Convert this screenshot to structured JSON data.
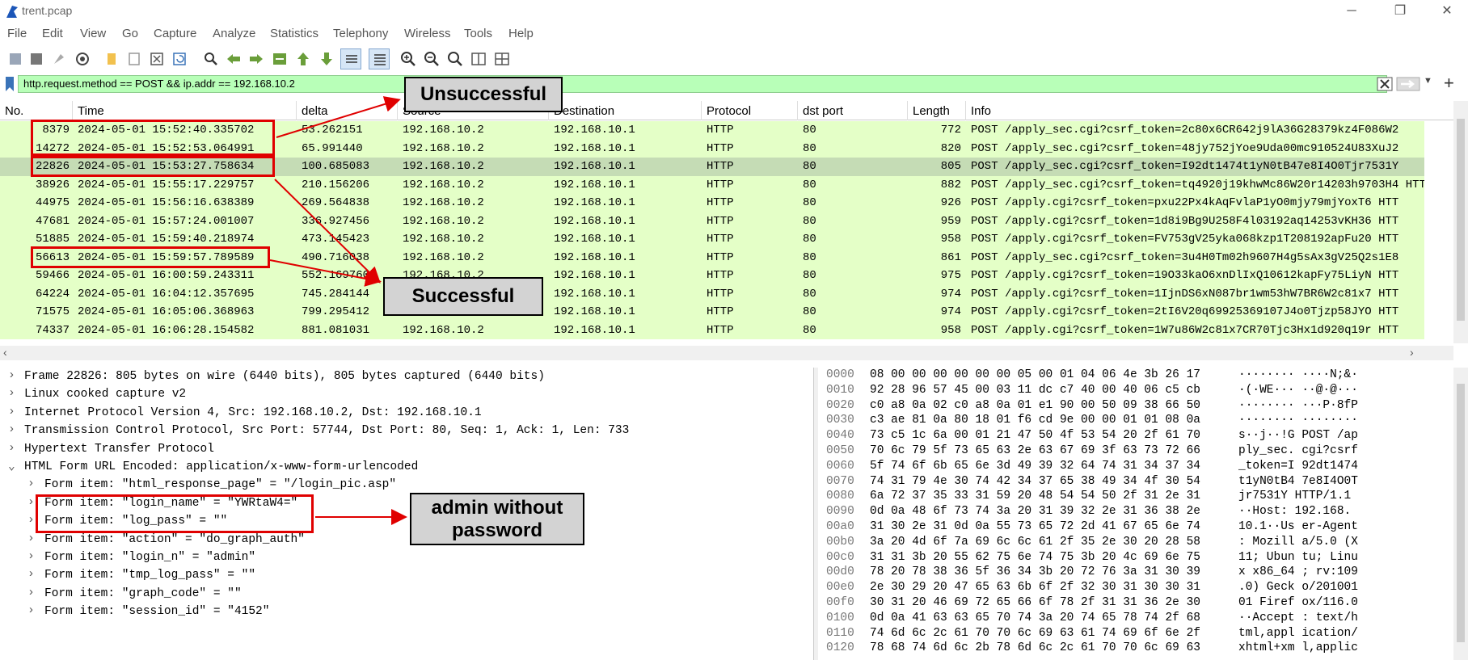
{
  "window": {
    "title": "trent.pcap"
  },
  "menu": [
    "File",
    "Edit",
    "View",
    "Go",
    "Capture",
    "Analyze",
    "Statistics",
    "Telephony",
    "Wireless",
    "Tools",
    "Help"
  ],
  "filter": {
    "value": "http.request.method == POST && ip.addr == 192.168.10.2"
  },
  "columns": [
    "No.",
    "Time",
    "delta",
    "Source",
    "Destination",
    "Protocol",
    "dst port",
    "Length",
    "Info"
  ],
  "packets": [
    {
      "no": "8379",
      "time": "2024-05-01 15:52:40.335702",
      "delta": "53.262151",
      "src": "192.168.10.2",
      "dst": "192.168.10.1",
      "proto": "HTTP",
      "port": "80",
      "len": "772",
      "info": "POST /apply_sec.cgi?csrf_token=2c80x6CR642j9lA36G28379kz4F086W2"
    },
    {
      "no": "14272",
      "time": "2024-05-01 15:52:53.064991",
      "delta": "65.991440",
      "src": "192.168.10.2",
      "dst": "192.168.10.1",
      "proto": "HTTP",
      "port": "80",
      "len": "820",
      "info": "POST /apply_sec.cgi?csrf_token=48jy752jYoe9Uda00mc910524U83XuJ2"
    },
    {
      "no": "22826",
      "time": "2024-05-01 15:53:27.758634",
      "delta": "100.685083",
      "src": "192.168.10.2",
      "dst": "192.168.10.1",
      "proto": "HTTP",
      "port": "80",
      "len": "805",
      "info": "POST /apply_sec.cgi?csrf_token=I92dt1474t1yN0tB47e8I4O0Tjr7531Y"
    },
    {
      "no": "38926",
      "time": "2024-05-01 15:55:17.229757",
      "delta": "210.156206",
      "src": "192.168.10.2",
      "dst": "192.168.10.1",
      "proto": "HTTP",
      "port": "80",
      "len": "882",
      "info": "POST /apply_sec.cgi?csrf_token=tq4920j19khwMc86W20r14203h9703H4  HTT"
    },
    {
      "no": "44975",
      "time": "2024-05-01 15:56:16.638389",
      "delta": "269.564838",
      "src": "192.168.10.2",
      "dst": "192.168.10.1",
      "proto": "HTTP",
      "port": "80",
      "len": "926",
      "info": "POST /apply.cgi?csrf_token=pxu22Px4kAqFvlaP1yO0mjy79mjYoxT6  HTT"
    },
    {
      "no": "47681",
      "time": "2024-05-01 15:57:24.001007",
      "delta": "336.927456",
      "src": "192.168.10.2",
      "dst": "192.168.10.1",
      "proto": "HTTP",
      "port": "80",
      "len": "959",
      "info": "POST /apply.cgi?csrf_token=1d8i9Bg9U258F4l03192aq14253vKH36  HTT"
    },
    {
      "no": "51885",
      "time": "2024-05-01 15:59:40.218974",
      "delta": "473.145423",
      "src": "192.168.10.2",
      "dst": "192.168.10.1",
      "proto": "HTTP",
      "port": "80",
      "len": "958",
      "info": "POST /apply.cgi?csrf_token=FV753gV25yka068kzp1T208192apFu20  HTT"
    },
    {
      "no": "56613",
      "time": "2024-05-01 15:59:57.789589",
      "delta": "490.716038",
      "src": "192.168.10.2",
      "dst": "192.168.10.1",
      "proto": "HTTP",
      "port": "80",
      "len": "861",
      "info": "POST /apply_sec.cgi?csrf_token=3u4H0Tm02h9607H4g5sAx3gV25Q2s1E8"
    },
    {
      "no": "59466",
      "time": "2024-05-01 16:00:59.243311",
      "delta": "552.169760",
      "src": "192.168.10.2",
      "dst": "192.168.10.1",
      "proto": "HTTP",
      "port": "80",
      "len": "975",
      "info": "POST /apply.cgi?csrf_token=19O33kaO6xnDlIxQ10612kapFy75LiyN  HTT"
    },
    {
      "no": "64224",
      "time": "2024-05-01 16:04:12.357695",
      "delta": "745.284144",
      "src": "192.168.10.2",
      "dst": "192.168.10.1",
      "proto": "HTTP",
      "port": "80",
      "len": "974",
      "info": "POST /apply.cgi?csrf_token=1IjnDS6xN087br1wm53hW7BR6W2c81x7  HTT"
    },
    {
      "no": "71575",
      "time": "2024-05-01 16:05:06.368963",
      "delta": "799.295412",
      "src": "192.168.10.2",
      "dst": "192.168.10.1",
      "proto": "HTTP",
      "port": "80",
      "len": "974",
      "info": "POST /apply.cgi?csrf_token=2tI6V20q69925369107J4o0Tjzp58JYO  HTT"
    },
    {
      "no": "74337",
      "time": "2024-05-01 16:06:28.154582",
      "delta": "881.081031",
      "src": "192.168.10.2",
      "dst": "192.168.10.1",
      "proto": "HTTP",
      "port": "80",
      "len": "958",
      "info": "POST /apply.cgi?csrf_token=1W7u86W2c81x7CR70Tjc3Hx1d920q19r  HTT"
    }
  ],
  "details": [
    {
      "text": "Frame 22826: 805 bytes on wire (6440 bits), 805 bytes captured (6440 bits)",
      "chev": "›",
      "child": false
    },
    {
      "text": "Linux cooked capture v2",
      "chev": "›",
      "child": false
    },
    {
      "text": "Internet Protocol Version 4, Src: 192.168.10.2, Dst: 192.168.10.1",
      "chev": "›",
      "child": false
    },
    {
      "text": "Transmission Control Protocol, Src Port: 57744, Dst Port: 80, Seq: 1, Ack: 1, Len: 733",
      "chev": "›",
      "child": false
    },
    {
      "text": "Hypertext Transfer Protocol",
      "chev": "›",
      "child": false
    },
    {
      "text": "HTML Form URL Encoded: application/x-www-form-urlencoded",
      "chev": "⌄",
      "child": false
    },
    {
      "text": "Form item: \"html_response_page\" = \"/login_pic.asp\"",
      "chev": "›",
      "child": true
    },
    {
      "text": "Form item: \"login_name\" = \"YWRtaW4=\"",
      "chev": "›",
      "child": true
    },
    {
      "text": "Form item: \"log_pass\" = \"\"",
      "chev": "›",
      "child": true
    },
    {
      "text": "Form item: \"action\" = \"do_graph_auth\"",
      "chev": "›",
      "child": true
    },
    {
      "text": "Form item: \"login_n\" = \"admin\"",
      "chev": "›",
      "child": true
    },
    {
      "text": "Form item: \"tmp_log_pass\" = \"\"",
      "chev": "›",
      "child": true
    },
    {
      "text": "Form item: \"graph_code\" = \"\"",
      "chev": "›",
      "child": true
    },
    {
      "text": "Form item: \"session_id\" = \"4152\"",
      "chev": "›",
      "child": true
    }
  ],
  "hex": [
    {
      "off": "0000",
      "bytes": "08 00 00 00 00 00 00 05  00 01 04 06 4e 3b 26 17",
      "ascii": "········ ····N;&·"
    },
    {
      "off": "0010",
      "bytes": "92 28 96 57 45 00 03 11  dc c7 40 00 40 06 c5 cb",
      "ascii": "·(·WE··· ··@·@···"
    },
    {
      "off": "0020",
      "bytes": "c0 a8 0a 02 c0 a8 0a 01  e1 90 00 50 09 38 66 50",
      "ascii": "········ ···P·8fP"
    },
    {
      "off": "0030",
      "bytes": "c3 ae 81 0a 80 18 01 f6  cd 9e 00 00 01 01 08 0a",
      "ascii": "········ ········"
    },
    {
      "off": "0040",
      "bytes": "73 c5 1c 6a 00 01 21 47  50 4f 53 54 20 2f 61 70",
      "ascii": "s··j··!G POST /ap"
    },
    {
      "off": "0050",
      "bytes": "70 6c 79 5f 73 65 63 2e  63 67 69 3f 63 73 72 66",
      "ascii": "ply_sec. cgi?csrf"
    },
    {
      "off": "0060",
      "bytes": "5f 74 6f 6b 65 6e 3d 49  39 32 64 74 31 34 37 34",
      "ascii": "_token=I 92dt1474"
    },
    {
      "off": "0070",
      "bytes": "74 31 79 4e 30 74 42 34  37 65 38 49 34 4f 30 54",
      "ascii": "t1yN0tB4 7e8I4O0T"
    },
    {
      "off": "0080",
      "bytes": "6a 72 37 35 33 31 59 20  48 54 54 50 2f 31 2e 31",
      "ascii": "jr7531Y  HTTP/1.1"
    },
    {
      "off": "0090",
      "bytes": "0d 0a 48 6f 73 74 3a 20  31 39 32 2e 31 36 38 2e",
      "ascii": "··Host:  192.168."
    },
    {
      "off": "00a0",
      "bytes": "31 30 2e 31 0d 0a 55 73  65 72 2d 41 67 65 6e 74",
      "ascii": "10.1··Us er-Agent"
    },
    {
      "off": "00b0",
      "bytes": "3a 20 4d 6f 7a 69 6c 6c  61 2f 35 2e 30 20 28 58",
      "ascii": ": Mozill a/5.0 (X"
    },
    {
      "off": "00c0",
      "bytes": "31 31 3b 20 55 62 75 6e  74 75 3b 20 4c 69 6e 75",
      "ascii": "11; Ubun tu; Linu"
    },
    {
      "off": "00d0",
      "bytes": "78 20 78 38 36 5f 36 34  3b 20 72 76 3a 31 30 39",
      "ascii": "x x86_64 ; rv:109"
    },
    {
      "off": "00e0",
      "bytes": "2e 30 29 20 47 65 63 6b  6f 2f 32 30 31 30 30 31",
      "ascii": ".0) Geck o/201001"
    },
    {
      "off": "00f0",
      "bytes": "30 31 20 46 69 72 65 66  6f 78 2f 31 31 36 2e 30",
      "ascii": "01 Firef ox/116.0"
    },
    {
      "off": "0100",
      "bytes": "0d 0a 41 63 63 65 70 74  3a 20 74 65 78 74 2f 68",
      "ascii": "··Accept : text/h"
    },
    {
      "off": "0110",
      "bytes": "74 6d 6c 2c 61 70 70 6c  69 63 61 74 69 6f 6e 2f",
      "ascii": "tml,appl ication/"
    },
    {
      "off": "0120",
      "bytes": "78 68 74 6d 6c 2b 78 6d  6c 2c 61 70 70 6c 69 63",
      "ascii": "xhtml+xm l,applic"
    }
  ],
  "annotations": {
    "unsuccessful": "Unsuccessful",
    "successful": "Successful",
    "admin_line1": "admin without",
    "admin_line2": "password"
  }
}
